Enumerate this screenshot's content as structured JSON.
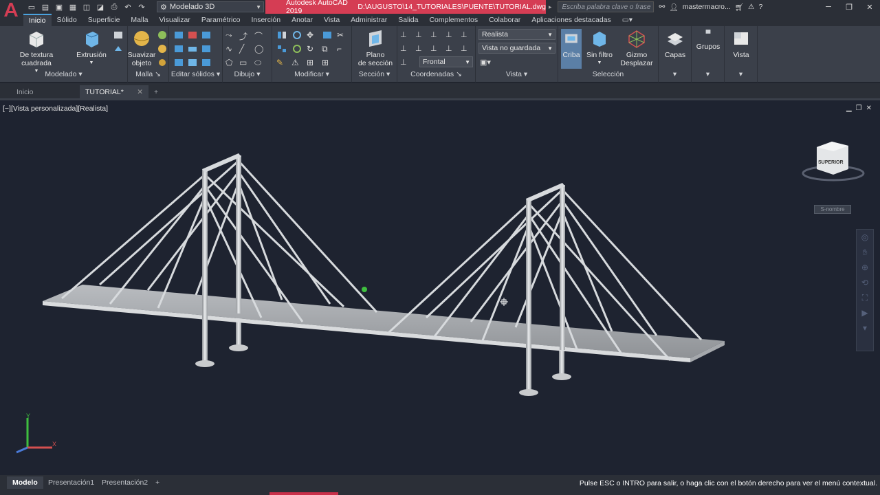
{
  "titlebar": {
    "app_name": "Autodesk AutoCAD 2019",
    "file_path": "D:\\AUGUSTO\\14_TUTORIALES\\PUENTE\\TUTORIAL.dwg",
    "workspace": "Modelado 3D",
    "search_placeholder": "Escriba palabra clave o frase",
    "username": "mastermacro...",
    "accent_color": "#d53d54"
  },
  "ribbon_tabs": [
    "Inicio",
    "Sólido",
    "Superficie",
    "Malla",
    "Visualizar",
    "Paramétrico",
    "Inserción",
    "Anotar",
    "Vista",
    "Administrar",
    "Salida",
    "Complementos",
    "Colaborar",
    "Aplicaciones destacadas"
  ],
  "ribbon": {
    "modelado": {
      "btn1": "De textura cuadrada",
      "btn2": "Extrusión",
      "label": "Modelado"
    },
    "malla": {
      "btn1_line1": "Suavizar",
      "btn1_line2": "objeto",
      "label": "Malla"
    },
    "editar_solidos": {
      "label": "Editar sólidos"
    },
    "dibujo": {
      "label": "Dibujo"
    },
    "modificar": {
      "label": "Modificar"
    },
    "seccion": {
      "btn_line1": "Plano",
      "btn_line2": "de sección",
      "label": "Sección"
    },
    "coordenadas": {
      "label": "Coordenadas",
      "view_dd": "Frontal"
    },
    "vista": {
      "style_dd": "Realista",
      "view_dd": "Vista no guardada",
      "label": "Vista"
    },
    "seleccion": {
      "criba": "Criba",
      "filtro": "Sin filtro",
      "gizmo_line1": "Gizmo",
      "gizmo_line2": "Desplazar",
      "label": "Selección"
    },
    "capas": "Capas",
    "grupos": "Grupos",
    "vista2": "Vista"
  },
  "doc_tabs": [
    "Inicio",
    "TUTORIAL*"
  ],
  "viewport": {
    "label": "[−][Vista personalizada][Realista]",
    "viewcube_face": "SUPERIOR",
    "wcs_label": "S-nombre",
    "axis_x": "X",
    "axis_y": "Y"
  },
  "layout_tabs": [
    "Modelo",
    "Presentación1",
    "Presentación2"
  ],
  "status_message": "Pulse ESC o INTRO para salir, o haga clic con el botón derecho para ver el menú contextual."
}
